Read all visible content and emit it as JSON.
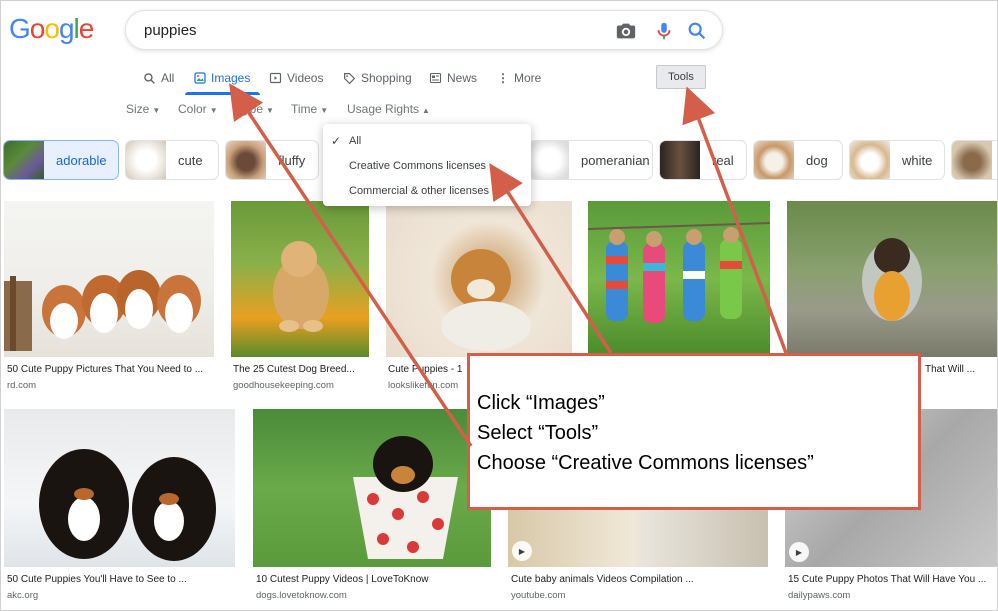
{
  "header": {
    "logo": [
      "G",
      "o",
      "o",
      "g",
      "l",
      "e"
    ],
    "logo_colors": [
      "#4285F4",
      "#EA4335",
      "#FBBC05",
      "#4285F4",
      "#34A853",
      "#EA4335"
    ],
    "query": "puppies"
  },
  "tabs": [
    {
      "label": "All",
      "icon": "search-icon"
    },
    {
      "label": "Images",
      "icon": "image-icon"
    },
    {
      "label": "Videos",
      "icon": "video-icon"
    },
    {
      "label": "Shopping",
      "icon": "tag-icon"
    },
    {
      "label": "News",
      "icon": "news-icon"
    },
    {
      "label": "More",
      "icon": "more-vert-icon"
    }
  ],
  "tools_label": "Tools",
  "filters": [
    "Size",
    "Color",
    "Type",
    "Time",
    "Usage Rights"
  ],
  "chips": [
    "adorable",
    "cute",
    "fluffy",
    "pomeranian",
    "real",
    "dog",
    "white"
  ],
  "usage_menu": {
    "items": [
      "All",
      "Creative Commons licenses",
      "Commercial & other licenses"
    ],
    "checked_index": 0
  },
  "results_row1": [
    {
      "title": "50 Cute Puppy Pictures That You Need to ...",
      "source": "rd.com"
    },
    {
      "title": "The 25 Cutest Dog Breed...",
      "source": "goodhousekeeping.com"
    },
    {
      "title": "Cute Puppies - 1",
      "source": "lookslikefun.com"
    },
    {
      "title": "",
      "source": ""
    },
    {
      "title": "That Will ...",
      "source": ""
    }
  ],
  "results_row2": [
    {
      "title": "50 Cute Puppies You'll Have to See to ...",
      "source": "akc.org"
    },
    {
      "title": "10 Cutest Puppy Videos | LoveToKnow",
      "source": "dogs.lovetoknow.com"
    },
    {
      "title": "Cute baby animals Videos Compilation ...",
      "source": "youtube.com"
    },
    {
      "title": "15 Cute Puppy Photos That Will Have You ...",
      "source": "dailypaws.com"
    }
  ],
  "annotation": {
    "lines": [
      "Click “Images”",
      "Select “Tools”",
      "Choose “Creative Commons licenses”"
    ],
    "color": "#d35f4a"
  },
  "colors": {
    "accent": "#1a73e8",
    "annotation": "#d35f4a"
  }
}
